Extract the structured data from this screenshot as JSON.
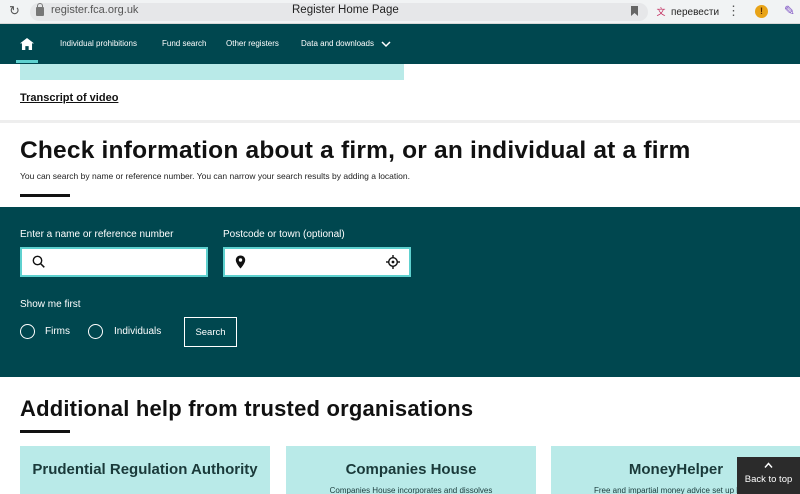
{
  "browser": {
    "url": "register.fca.org.uk",
    "tab_title": "Register Home Page",
    "translate_label": "перевести"
  },
  "nav": {
    "items": [
      {
        "label": "Individual prohibitions"
      },
      {
        "label": "Fund search"
      },
      {
        "label": "Other registers"
      },
      {
        "label": "Data and downloads"
      }
    ]
  },
  "video": {
    "transcript_label": "Transcript of video"
  },
  "search_section": {
    "heading": "Check information about a firm, or an individual at a firm",
    "subtext": "You can search by name or reference number. You can narrow your search results by adding a location.",
    "name_label": "Enter a name or reference number",
    "name_value": "",
    "location_label": "Postcode or town (optional)",
    "location_value": "",
    "show_me_first_label": "Show me first",
    "options": [
      {
        "label": "Firms",
        "selected": false
      },
      {
        "label": "Individuals",
        "selected": false
      }
    ],
    "search_button": "Search"
  },
  "help_section": {
    "heading": "Additional help from trusted organisations",
    "cards": [
      {
        "title": "Prudential Regulation Authority",
        "desc": ""
      },
      {
        "title": "Companies House",
        "desc": "Companies House incorporates and dissolves"
      },
      {
        "title": "MoneyHelper",
        "desc": "Free and impartial money advice set up by the"
      }
    ]
  },
  "back_to_top": "Back to top",
  "colors": {
    "primary": "#00474f",
    "accent": "#5ed1cf",
    "card": "#b9eae8"
  }
}
